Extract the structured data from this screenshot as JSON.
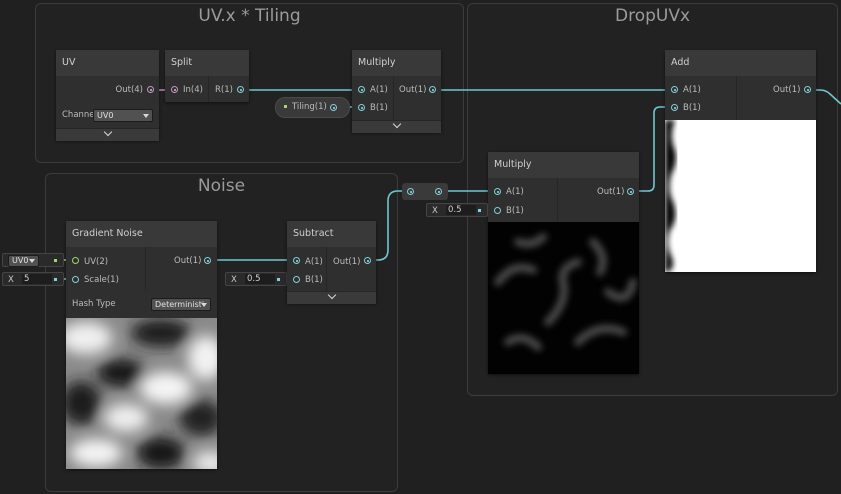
{
  "groups": {
    "tiling": "UV.x * Tiling",
    "dropuvx": "DropUVx",
    "noise": "Noise"
  },
  "uv_node": {
    "title": "UV",
    "out_label": "Out(4)",
    "channel_label": "Channe",
    "channel_value": "UV0"
  },
  "split_node": {
    "title": "Split",
    "in_label": "In(4)",
    "r_label": "R(1)"
  },
  "multiply_top": {
    "title": "Multiply",
    "a_label": "A(1)",
    "b_label": "B(1)",
    "out_label": "Out(1)"
  },
  "tiling_property": {
    "label": "Tiling(1)"
  },
  "add_node": {
    "title": "Add",
    "a_label": "A(1)",
    "b_label": "B(1)",
    "out_label": "Out(1)"
  },
  "multiply_mid": {
    "title": "Multiply",
    "a_label": "A(1)",
    "b_label": "B(1)",
    "out_label": "Out(1)",
    "b_field_axis": "X",
    "b_field_value": "0.5"
  },
  "gradient_noise": {
    "title": "Gradient Noise",
    "uv_label": "UV(2)",
    "scale_label": "Scale(1)",
    "out_label": "Out(1)",
    "hash_label": "Hash Type",
    "hash_value": "Deterministi",
    "uv_input_value": "UV0",
    "scale_axis": "X",
    "scale_value": "5"
  },
  "subtract_node": {
    "title": "Subtract",
    "a_label": "A(1)",
    "b_label": "B(1)",
    "out_label": "Out(1)",
    "b_field_axis": "X",
    "b_field_value": "0.5"
  },
  "colors": {
    "background": "#202020",
    "wire_float": "#6fc6d2",
    "wire_vector4": "#c98bc7",
    "wire_vector2": "#a4d373"
  }
}
